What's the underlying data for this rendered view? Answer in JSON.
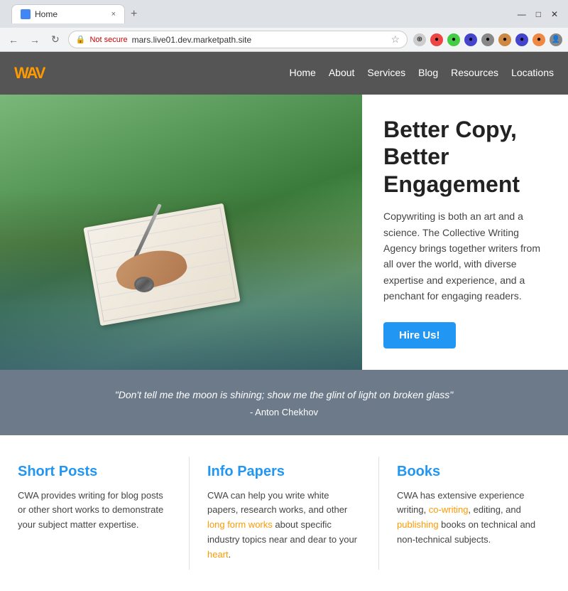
{
  "browser": {
    "tab_title": "Home",
    "new_tab_label": "+",
    "close_tab_label": "×",
    "nav_back": "←",
    "nav_forward": "→",
    "nav_reload": "↻",
    "security_label": "Not secure",
    "address": "mars.live01.dev.marketpath.site",
    "window_min": "—",
    "window_max": "□",
    "window_close": "✕"
  },
  "nav": {
    "logo": "WAV",
    "links": [
      {
        "label": "Home",
        "href": "#"
      },
      {
        "label": "About",
        "href": "#"
      },
      {
        "label": "Services",
        "href": "#"
      },
      {
        "label": "Blog",
        "href": "#"
      },
      {
        "label": "Resources",
        "href": "#"
      },
      {
        "label": "Locations",
        "href": "#"
      }
    ]
  },
  "hero": {
    "title": "Better Copy, Better Engagement",
    "description": "Copywriting is both an art and a science. The Collective Writing Agency brings together writers from all over the world, with diverse expertise and experience, and a penchant for engaging readers.",
    "cta_label": "Hire Us!"
  },
  "quote": {
    "text": "\"Don't tell me the moon is shining; show me the glint of light on broken glass\"",
    "author": "- Anton Chekhov"
  },
  "cards": [
    {
      "title": "Short Posts",
      "text": "CWA provides writing for blog posts or other short works to demonstrate your subject matter expertise."
    },
    {
      "title": "Info Papers",
      "text": "CWA can help you write white papers, research works, and other long form works about specific industry topics near and dear to your heart."
    },
    {
      "title": "Books",
      "text": "CWA has extensive experience writing, co-writing, editing, and publishing books on technical and non-technical subjects."
    }
  ]
}
